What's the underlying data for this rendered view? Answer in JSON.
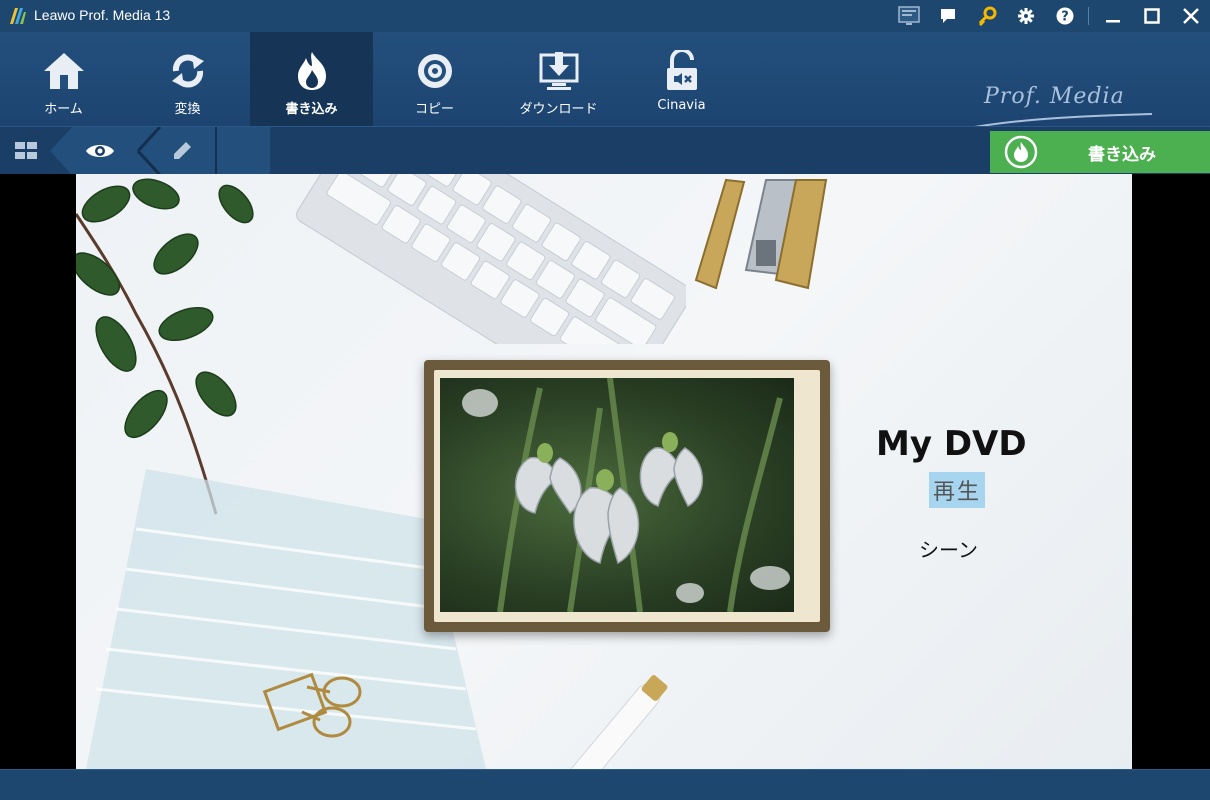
{
  "window": {
    "title": "Leawo Prof. Media 13"
  },
  "toolbar": {
    "items": [
      {
        "label": "ホーム",
        "icon": "home-icon"
      },
      {
        "label": "変換",
        "icon": "convert-icon"
      },
      {
        "label": "書き込み",
        "icon": "burn-icon",
        "active": true
      },
      {
        "label": "コピー",
        "icon": "copy-icon"
      },
      {
        "label": "ダウンロード",
        "icon": "download-icon"
      },
      {
        "label": "Cinavia",
        "icon": "cinavia-icon"
      }
    ],
    "brand": "Prof. Media"
  },
  "subbar": {
    "burn_label": "書き込み"
  },
  "preview": {
    "menu_title": "My DVD",
    "play_label": "再生",
    "scene_label": "シーン"
  },
  "colors": {
    "titlebar": "#1e4770",
    "toolbar_active": "#163556",
    "burn_button": "#4caf50",
    "play_highlight": "#a7d5ef"
  }
}
